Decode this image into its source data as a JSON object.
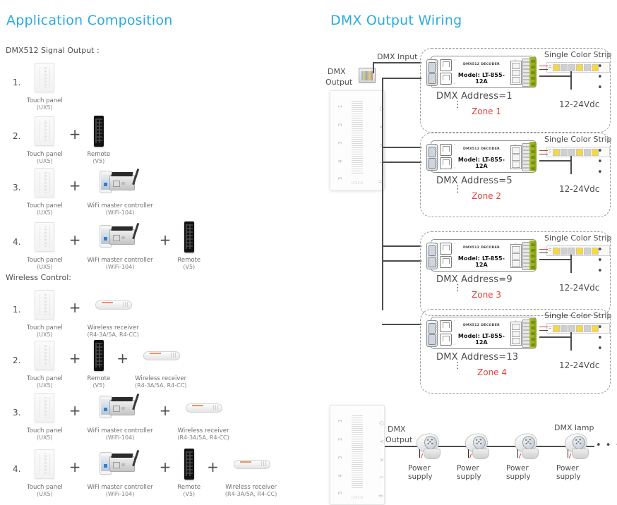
{
  "left": {
    "title": "Application Composition",
    "dmx_section_label": "DMX512 Signal Output :",
    "wireless_section_label": "Wireless Control:",
    "devices": {
      "touch_panel": {
        "name": "Touch panel",
        "model": "(UX5)"
      },
      "remote": {
        "name": "Remote",
        "model": "(V5)"
      },
      "wifi": {
        "name": "WiFi master controller",
        "model": "(WiFi-104)"
      },
      "receiver": {
        "name": "Wireless receiver",
        "model": "(R4-3A/5A, R4-CC)"
      }
    },
    "plus_symbol": "+",
    "dmx_rows": [
      {
        "index": "1.",
        "items": [
          "touch_panel"
        ]
      },
      {
        "index": "2.",
        "items": [
          "touch_panel",
          "remote"
        ]
      },
      {
        "index": "3.",
        "items": [
          "touch_panel",
          "wifi"
        ]
      },
      {
        "index": "4.",
        "items": [
          "touch_panel",
          "wifi",
          "remote"
        ]
      }
    ],
    "wireless_rows": [
      {
        "index": "1.",
        "items": [
          "touch_panel",
          "receiver"
        ]
      },
      {
        "index": "2.",
        "items": [
          "touch_panel",
          "remote",
          "receiver"
        ]
      },
      {
        "index": "3.",
        "items": [
          "touch_panel",
          "wifi",
          "receiver"
        ]
      },
      {
        "index": "4.",
        "items": [
          "touch_panel",
          "wifi",
          "remote",
          "receiver"
        ]
      }
    ]
  },
  "right": {
    "title": "DMX Output Wiring",
    "dmx_input_label": "DMX Input",
    "dmx_output_label_top": "DMX\nOutput",
    "dmx_output_label_line1": "DMX",
    "dmx_output_label_line2": "Output",
    "decoder": {
      "brand_line": "DMX512 DECODER",
      "model_line": "Model: LT-855-12A"
    },
    "strip_label": "Single Color Strip",
    "strip_dots": "• • •",
    "voltage_label": "12-24Vdc",
    "vertical_dots": "⋮",
    "zones": [
      {
        "address": "DMX Address=1",
        "zone": "Zone 1"
      },
      {
        "address": "DMX Address=5",
        "zone": "Zone 2"
      },
      {
        "address": "DMX Address=9",
        "zone": "Zone 3"
      },
      {
        "address": "DMX Address=13",
        "zone": "Zone 4"
      }
    ],
    "lamp_row": {
      "dmx_lamp_label": "DMX lamp",
      "power_supply_label_line1": "Power",
      "power_supply_label_line2": "supply",
      "trailing_dots": "• • •",
      "lamp_count": 4
    },
    "touch_panel_face": {
      "numbers": [
        "1",
        "2",
        "3",
        "4",
        "5"
      ],
      "icons": [
        "⏻",
        "∧",
        "∨",
        "I",
        "II"
      ],
      "brand": "LTECH"
    }
  },
  "colors": {
    "title": "#29abe2",
    "zone_text": "#e8403a",
    "body_text": "#4d4d4d",
    "terminal_green": "#8ba417",
    "led_on": "#f7d93c"
  }
}
